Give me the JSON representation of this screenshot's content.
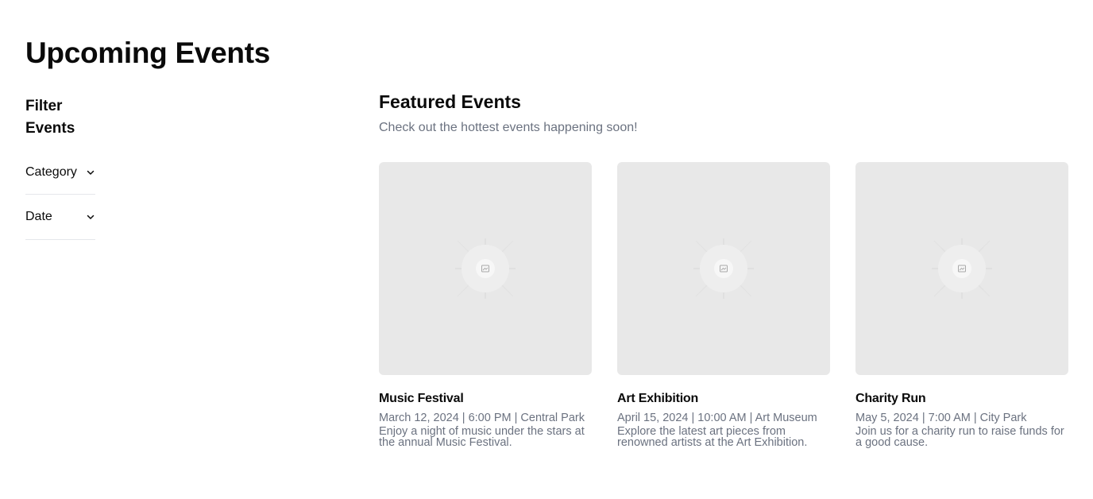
{
  "page": {
    "title": "Upcoming Events"
  },
  "sidebar": {
    "title": "Filter Events",
    "filters": [
      {
        "label": "Category",
        "icon": "chevron-down-icon"
      },
      {
        "label": "Date",
        "icon": "chevron-down-icon"
      }
    ]
  },
  "featured": {
    "title": "Featured Events",
    "subtitle": "Check out the hottest events happening soon!",
    "events": [
      {
        "title": "Music Festival",
        "meta": "March 12, 2024 | 6:00 PM | Central Park",
        "description": "Enjoy a night of music under the stars at the annual Music Festival.",
        "image_icon": "image-placeholder-icon"
      },
      {
        "title": "Art Exhibition",
        "meta": "April 15, 2024 | 10:00 AM | Art Museum",
        "description": "Explore the latest art pieces from renowned artists at the Art Exhibition.",
        "image_icon": "image-placeholder-icon"
      },
      {
        "title": "Charity Run",
        "meta": "May 5, 2024 | 7:00 AM | City Park",
        "description": "Join us for a charity run to raise funds for a good cause.",
        "image_icon": "image-placeholder-icon"
      }
    ]
  },
  "colors": {
    "text": "#0a0a0a",
    "muted": "#6b7280",
    "placeholder_bg": "#e8e8e8",
    "divider": "#e5e7eb"
  }
}
